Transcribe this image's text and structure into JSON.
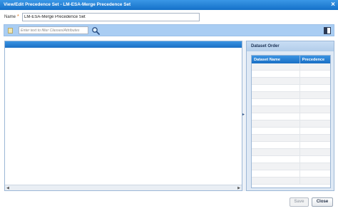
{
  "window": {
    "title": "View/Edit Precedence Set - LM-ESA-Merge Precedence Set"
  },
  "form": {
    "name_label": "Name",
    "required_marker": "*",
    "name_value": "LM-ESA-Merge Precedence Set"
  },
  "toolbar": {
    "filter_placeholder": "Enter text to filter Classes/Attributes",
    "icons": [
      "note-icon",
      "search-icon",
      "panel-toggle-icon"
    ]
  },
  "dataset_order": {
    "title": "Dataset Order",
    "columns": [
      "Dataset Name",
      "Precedence"
    ],
    "rows": []
  },
  "buttons": {
    "save": "Save",
    "close": "Close"
  },
  "colors": {
    "titlebar": "#1f7fd8",
    "toolbar": "#a9cdf3",
    "grid_header": "#2a82d6",
    "required": "#e07010"
  }
}
